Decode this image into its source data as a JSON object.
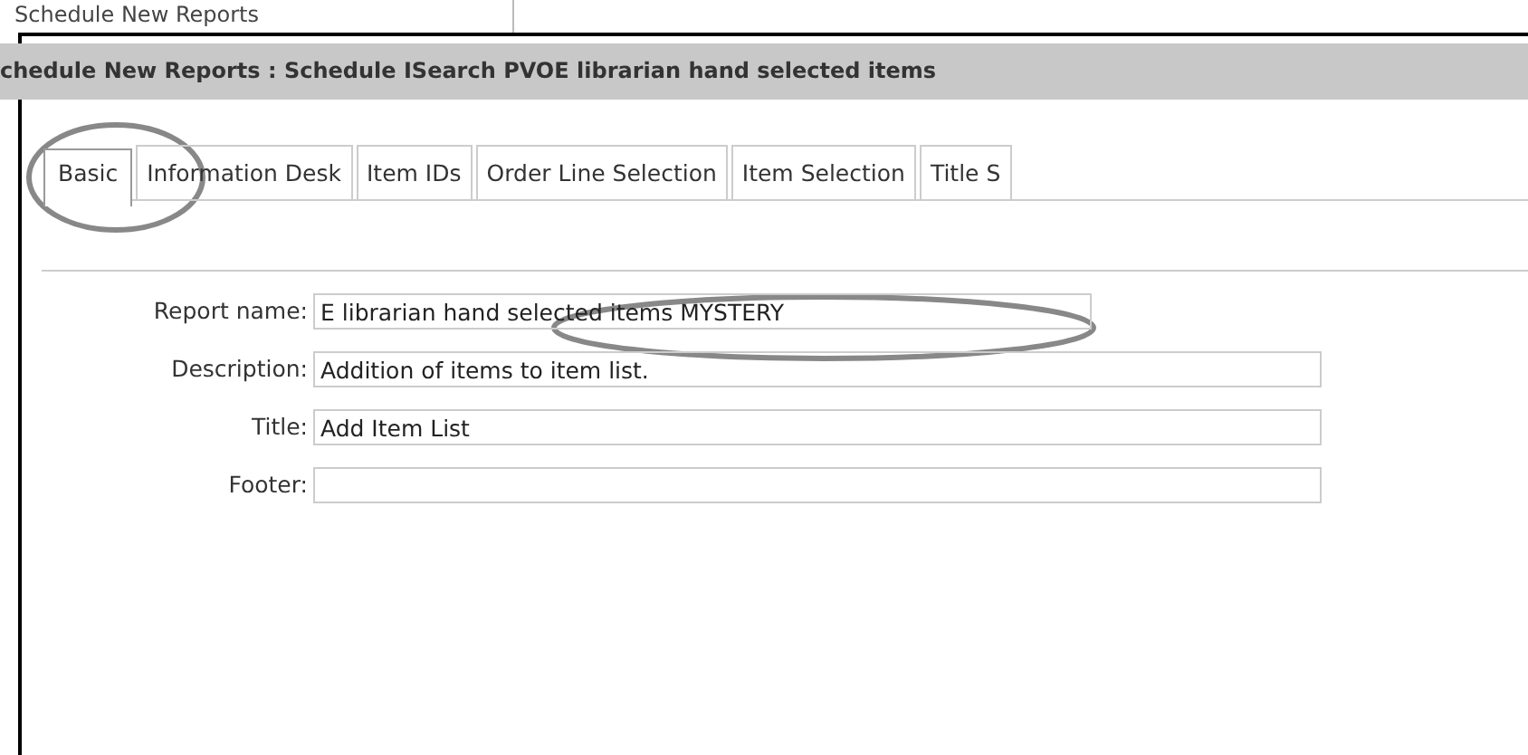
{
  "top_heading": "Schedule New Reports",
  "title_bar": "chedule New Reports : Schedule ISearch PVOE librarian hand selected items",
  "tabs": [
    {
      "label": "Basic",
      "selected": true
    },
    {
      "label": "Information Desk",
      "selected": false
    },
    {
      "label": "Item IDs",
      "selected": false
    },
    {
      "label": "Order Line Selection",
      "selected": false
    },
    {
      "label": "Item Selection",
      "selected": false
    },
    {
      "label": "Title S",
      "selected": false
    }
  ],
  "fields": [
    {
      "label": "Report name:",
      "value": "E librarian hand selected items MYSTERY",
      "kind": "short"
    },
    {
      "label": "Description:",
      "value": "Addition of items to item list.",
      "kind": "long"
    },
    {
      "label": "Title:",
      "value": "Add Item List",
      "kind": "long"
    },
    {
      "label": "Footer:",
      "kind": "long"
    }
  ]
}
